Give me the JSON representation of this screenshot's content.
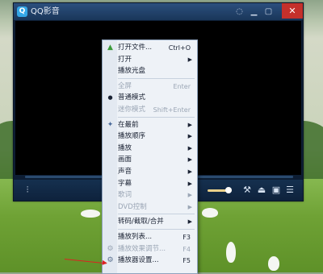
{
  "window": {
    "title": "QQ影音",
    "logo": "Q",
    "buttons": [
      "skin-icon",
      "minimize-icon",
      "maximize-icon",
      "close-icon"
    ]
  },
  "playback": {
    "progress": 0.0,
    "volume": 0.85
  },
  "menu": {
    "items": [
      {
        "key": "open_file",
        "label": "打开文件...",
        "shortcut": "Ctrl+O",
        "icon": "open-file-icon"
      },
      {
        "key": "open",
        "label": "打开",
        "submenu": true
      },
      {
        "key": "play_disc",
        "label": "播放光盘"
      },
      {
        "sep": true
      },
      {
        "key": "fullscreen",
        "label": "全屏",
        "shortcut": "Enter",
        "disabled": true
      },
      {
        "key": "normal_mode",
        "label": "普通模式",
        "checked": true
      },
      {
        "key": "mini_mode",
        "label": "迷你模式",
        "shortcut": "Shift+Enter",
        "disabled": true
      },
      {
        "sep": true
      },
      {
        "key": "on_top",
        "label": "在最前",
        "submenu": true,
        "icon": "pin-icon"
      },
      {
        "key": "play_order",
        "label": "播放顺序",
        "submenu": true
      },
      {
        "key": "play",
        "label": "播放",
        "submenu": true
      },
      {
        "key": "picture",
        "label": "画面",
        "submenu": true
      },
      {
        "key": "audio",
        "label": "声音",
        "submenu": true
      },
      {
        "key": "subtitle",
        "label": "字幕",
        "submenu": true
      },
      {
        "key": "lyrics",
        "label": "歌词",
        "submenu": true,
        "disabled": true
      },
      {
        "key": "dvd",
        "label": "DVD控制",
        "submenu": true,
        "disabled": true
      },
      {
        "sep": true
      },
      {
        "key": "convert",
        "label": "转码/截取/合并",
        "submenu": true
      },
      {
        "sep": true
      },
      {
        "key": "playlist",
        "label": "播放列表...",
        "shortcut": "F3"
      },
      {
        "key": "effects",
        "label": "播放效果调节...",
        "shortcut": "F4",
        "disabled": true,
        "icon": "effects-icon"
      },
      {
        "key": "settings",
        "label": "播放器设置...",
        "shortcut": "F5",
        "icon": "settings-icon"
      }
    ]
  }
}
